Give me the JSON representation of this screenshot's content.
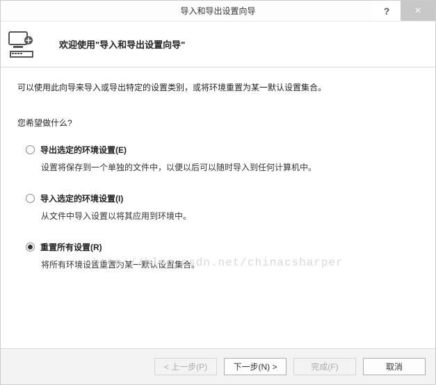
{
  "titlebar": {
    "title": "导入和导出设置向导",
    "help": "?",
    "close": "×"
  },
  "header": {
    "welcome": "欢迎使用\"导入和导出设置向导\""
  },
  "content": {
    "intro": "可以使用此向导来导入或导出特定的设置类别，或将环境重置为某一默认设置集合。",
    "prompt": "您希望做什么?",
    "options": [
      {
        "label": "导出选定的环境设置(E)",
        "desc": "设置将保存到一个单独的文件中，以便以后可以随时导入到任何计算机中。",
        "selected": false
      },
      {
        "label": "导入选定的环境设置(I)",
        "desc": "从文件中导入设置以将其应用到环境中。",
        "selected": false
      },
      {
        "label": "重置所有设置(R)",
        "desc": "将所有环境设置重置为某一默认设置集合。",
        "selected": true
      }
    ]
  },
  "watermark": "http://blog.csdn.net/chinacsharper",
  "footer": {
    "prev": "< 上一步(P)",
    "next": "下一步(N) >",
    "finish": "完成(F)",
    "cancel": "取消"
  }
}
